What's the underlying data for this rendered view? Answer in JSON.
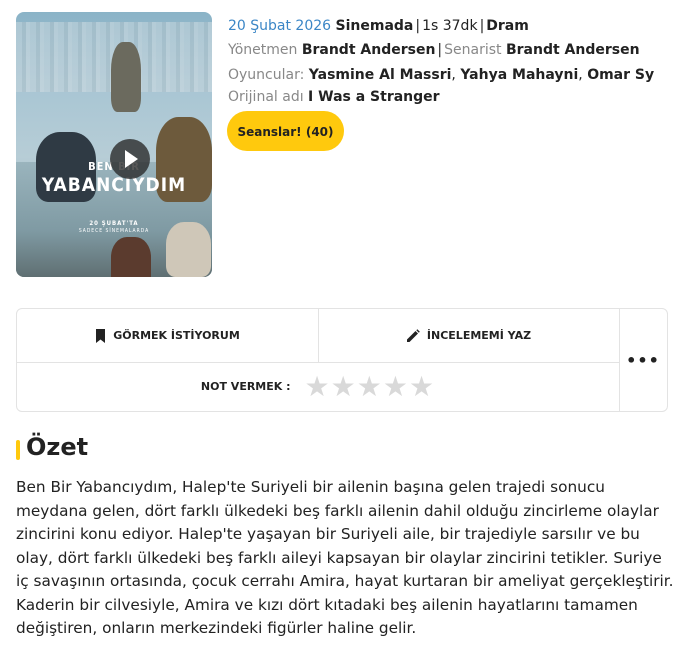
{
  "movie": {
    "release_date": "20 Şubat 2026",
    "release_status": "Sinemada",
    "duration": "1s 37dk",
    "genre": "Dram",
    "director_label": "Yönetmen",
    "director": "Brandt Andersen",
    "writer_label": "Senarist",
    "writer": "Brandt Andersen",
    "cast_label": "Oyuncular:",
    "cast": [
      "Yasmine Al Massri",
      "Yahya Mahayni",
      "Omar Sy"
    ],
    "original_title_label": "Orijinal adı",
    "original_title": "I Was a Stranger",
    "sessions_button": "Seanslar! (40)"
  },
  "poster": {
    "title_line1": "BEN BIR",
    "title_line2": "YABANCIYDIM",
    "date_line": "20 ŞUBAT'TA",
    "date_subline": "SADECE SİNEMALARDA"
  },
  "actions": {
    "watch_label": "GÖRMEK İSTİYORUM",
    "review_label": "İNCELEMEMİ YAZ",
    "rate_label": "NOT VERMEK :",
    "rating_stars_filled": 0,
    "rating_stars_total": 5,
    "more_label": "•••"
  },
  "summary": {
    "title": "Özet",
    "text": "Ben Bir Yabancıydım, Halep'te Suriyeli bir ailenin başına gelen trajedi sonucu meydana gelen, dört farklı ülkedeki beş farklı ailenin dahil olduğu zincirleme olaylar zincirini konu ediyor. Halep'te yaşayan bir Suriyeli aile, bir trajediyle sarsılır ve bu olay, dört farklı ülkedeki beş farklı aileyi kapsayan bir olaylar zincirini tetikler. Suriye iç savaşının ortasında, çocuk cerrahı Amira, hayat kurtaran bir ameliyat gerçekleştirir. Kaderin bir cilvesiyle, Amira ve kızı dört kıtadaki beş ailenin hayatlarını tamamen değiştiren, onların merkezindeki figürler haline gelir."
  },
  "colors": {
    "accent": "#ffc90d",
    "link_blue": "#3b86c6",
    "star_empty": "#d9d9d9"
  }
}
